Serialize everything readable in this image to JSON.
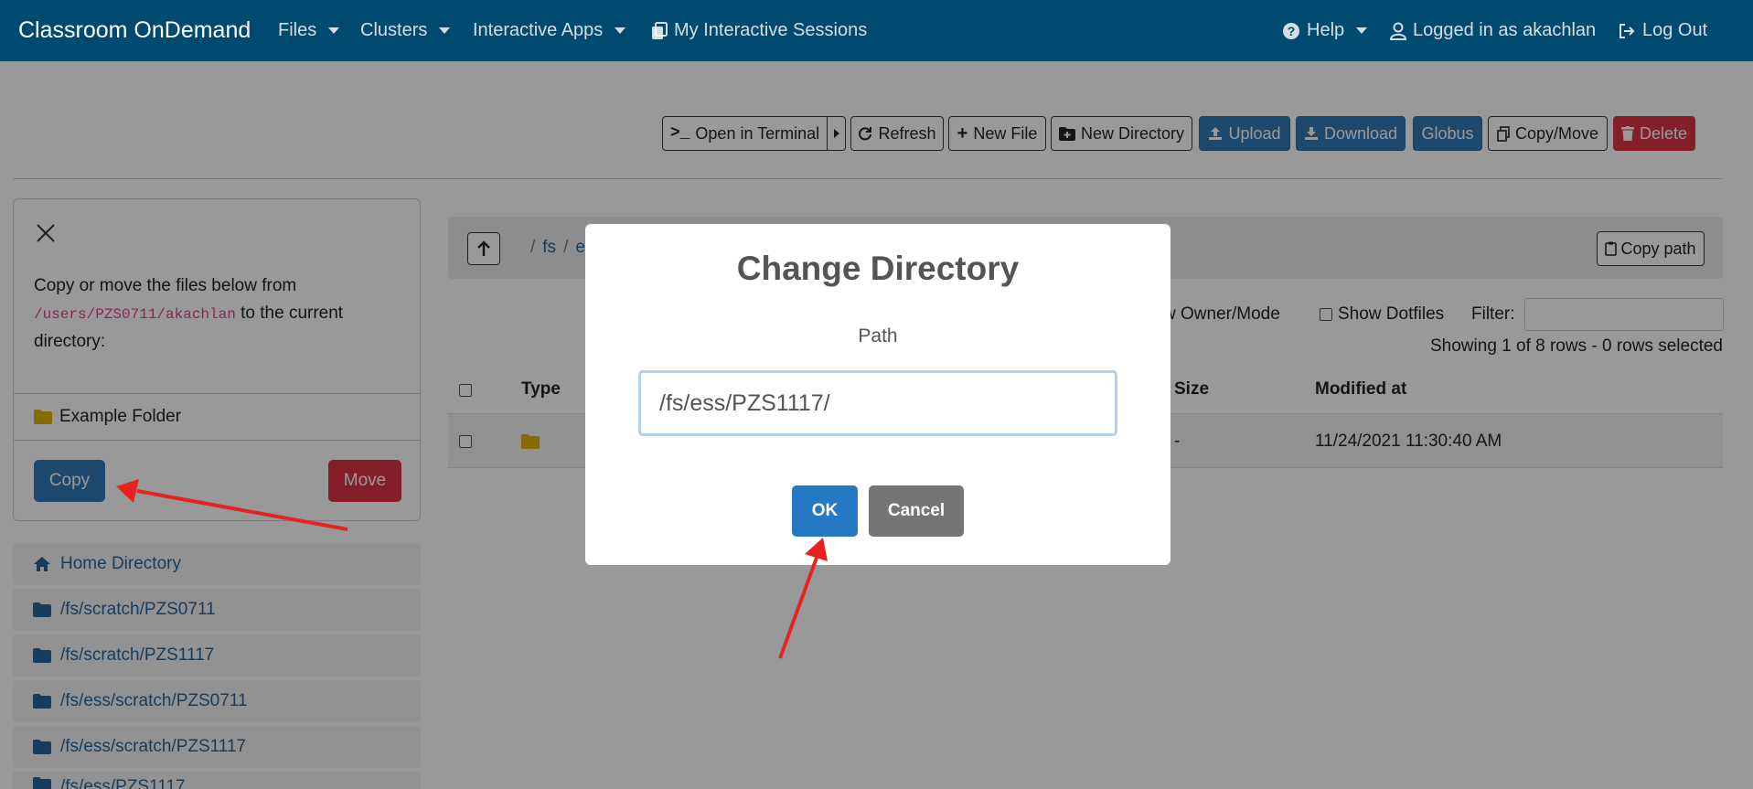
{
  "navbar": {
    "brand": "Classroom OnDemand",
    "menus": [
      "Files",
      "Clusters",
      "Interactive Apps"
    ],
    "sessions": "My Interactive Sessions",
    "help": "Help",
    "user": "Logged in as akachlan",
    "logout": "Log Out"
  },
  "toolbar": {
    "terminal": "Open in Terminal",
    "refresh": "Refresh",
    "new_file": "New File",
    "new_dir": "New Directory",
    "upload": "Upload",
    "download": "Download",
    "globus": "Globus",
    "copy_move": "Copy/Move",
    "delete": "Delete"
  },
  "sidebar": {
    "text_before": "Copy or move the files below from",
    "source_path": "/users/PZS0711/akachlan",
    "text_after": "to the current directory:",
    "file_name": "Example Folder",
    "copy_label": "Copy",
    "move_label": "Move",
    "favorites": [
      "Home Directory",
      "/fs/scratch/PZS0711",
      "/fs/scratch/PZS1117",
      "/fs/ess/scratch/PZS0711",
      "/fs/ess/scratch/PZS1117",
      "/fs/ess/PZS1117"
    ]
  },
  "main": {
    "breadcrumb": [
      "/",
      "fs",
      "/",
      "e"
    ],
    "copy_path": "Copy path",
    "show_owner": "w Owner/Mode",
    "show_dotfiles": "Show Dotfiles",
    "filter_label": "Filter:",
    "showing": "Showing 1 of 8 rows - 0 rows selected",
    "columns": {
      "type": "Type",
      "size": "Size",
      "modified": "Modified at"
    },
    "row": {
      "size": "-",
      "modified": "11/24/2021 11:30:40 AM"
    }
  },
  "modal": {
    "title": "Change Directory",
    "label": "Path",
    "value": "/fs/ess/PZS1117/",
    "ok": "OK",
    "cancel": "Cancel"
  },
  "colors": {
    "navbar": "#004a70",
    "primary": "#337ab7",
    "danger": "#dc3545",
    "ok": "#2778c4",
    "cancel": "#757575",
    "folder": "#e0b400",
    "annotation": "#e8231f"
  }
}
